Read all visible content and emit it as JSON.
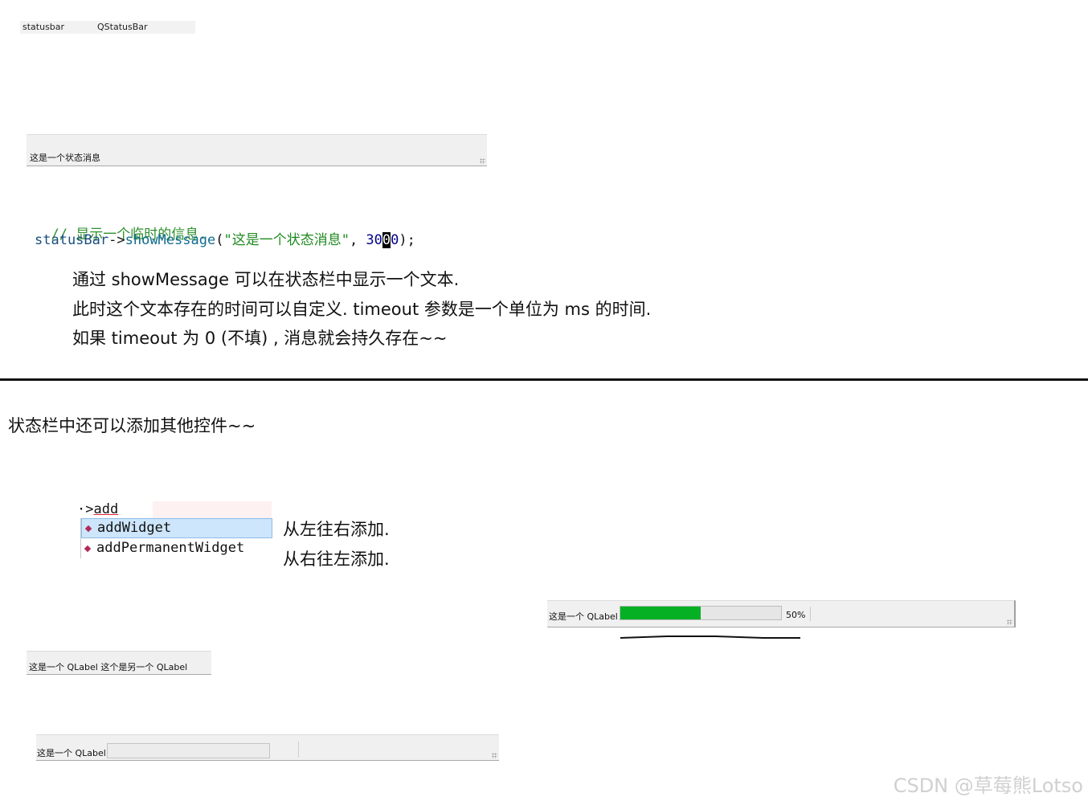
{
  "inspector": {
    "object_name": "statusbar",
    "class_name": "QStatusBar"
  },
  "statusbar_message": {
    "text": "这是一个状态消息"
  },
  "code": {
    "comment": "// 显示一个临时的信息.",
    "line_member": "statusBar",
    "line_arrow": "->",
    "line_func": "showMessage",
    "line_open": "(",
    "line_string": "\"这是一个状态消息\"",
    "line_comma": ", ",
    "line_num_a": "30",
    "line_num_cursor": "0",
    "line_num_b": "0",
    "line_close": ");"
  },
  "notes": [
    "通过 showMessage 可以在状态栏中显示一个文本.",
    "此时这个文本存在的时间可以自定义. timeout 参数是一个单位为 ms 的时间.",
    "如果 timeout 为 0  (不填) , 消息就会持久存在~~"
  ],
  "section2_heading": "状态栏中还可以添加其他控件~~",
  "autocomplete": {
    "typed_prefix": "·>",
    "typed_text": "add",
    "items": [
      {
        "label": "addWidget",
        "icon": "method-icon",
        "selected": true
      },
      {
        "label": "addPermanentWidget",
        "icon": "method-icon",
        "selected": false
      }
    ],
    "notes": [
      "从左往右添加.",
      "从右往左添加."
    ]
  },
  "progress_statusbar": {
    "label": "这是一个 QLabel",
    "progress_fraction": 0.5,
    "progress_text": "50%",
    "fill_color": "#06b025"
  },
  "two_labels_statusbar": {
    "text": "这是一个 QLabel 这个是另一个 QLabel"
  },
  "edit_statusbar": {
    "label": "这是一个 QLabel"
  },
  "watermark": "CSDN @草莓熊Lotso"
}
